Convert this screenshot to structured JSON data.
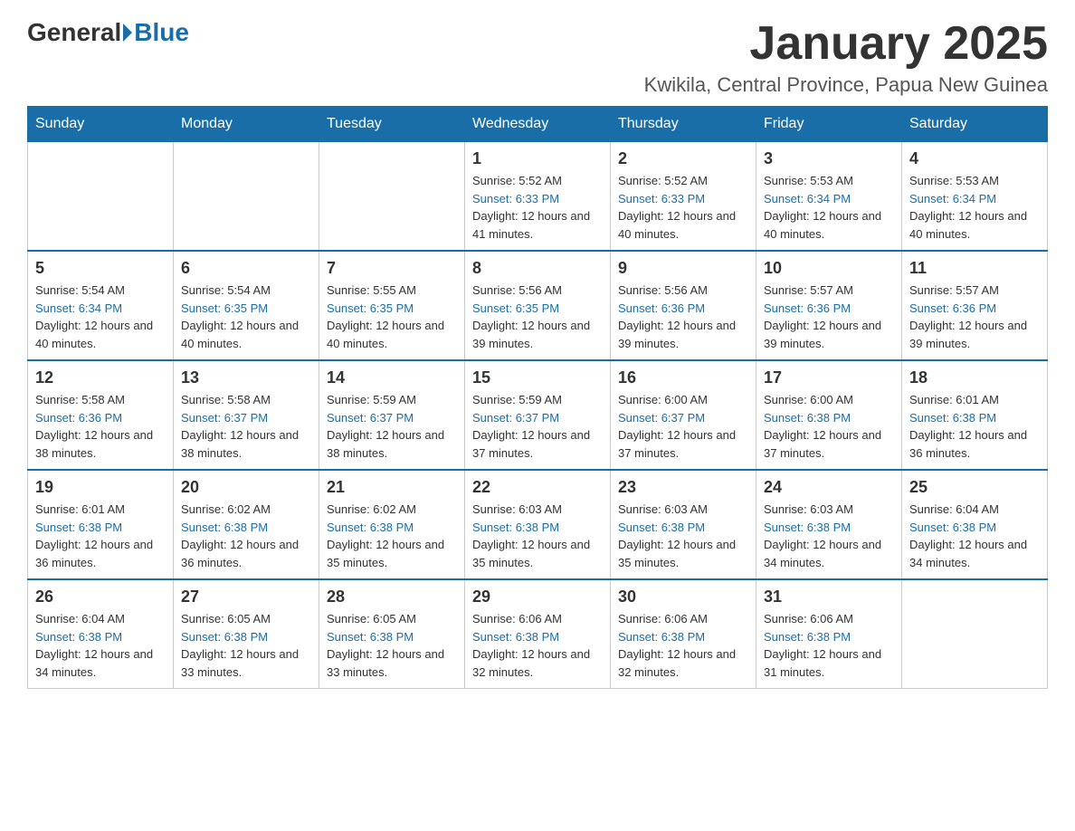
{
  "header": {
    "logo_general": "General",
    "logo_blue": "Blue",
    "month_title": "January 2025",
    "location": "Kwikila, Central Province, Papua New Guinea"
  },
  "days_of_week": [
    "Sunday",
    "Monday",
    "Tuesday",
    "Wednesday",
    "Thursday",
    "Friday",
    "Saturday"
  ],
  "weeks": [
    [
      {
        "day": "",
        "sunrise": "",
        "sunset": "",
        "daylight": ""
      },
      {
        "day": "",
        "sunrise": "",
        "sunset": "",
        "daylight": ""
      },
      {
        "day": "",
        "sunrise": "",
        "sunset": "",
        "daylight": ""
      },
      {
        "day": "1",
        "sunrise": "Sunrise: 5:52 AM",
        "sunset": "Sunset: 6:33 PM",
        "daylight": "Daylight: 12 hours and 41 minutes."
      },
      {
        "day": "2",
        "sunrise": "Sunrise: 5:52 AM",
        "sunset": "Sunset: 6:33 PM",
        "daylight": "Daylight: 12 hours and 40 minutes."
      },
      {
        "day": "3",
        "sunrise": "Sunrise: 5:53 AM",
        "sunset": "Sunset: 6:34 PM",
        "daylight": "Daylight: 12 hours and 40 minutes."
      },
      {
        "day": "4",
        "sunrise": "Sunrise: 5:53 AM",
        "sunset": "Sunset: 6:34 PM",
        "daylight": "Daylight: 12 hours and 40 minutes."
      }
    ],
    [
      {
        "day": "5",
        "sunrise": "Sunrise: 5:54 AM",
        "sunset": "Sunset: 6:34 PM",
        "daylight": "Daylight: 12 hours and 40 minutes."
      },
      {
        "day": "6",
        "sunrise": "Sunrise: 5:54 AM",
        "sunset": "Sunset: 6:35 PM",
        "daylight": "Daylight: 12 hours and 40 minutes."
      },
      {
        "day": "7",
        "sunrise": "Sunrise: 5:55 AM",
        "sunset": "Sunset: 6:35 PM",
        "daylight": "Daylight: 12 hours and 40 minutes."
      },
      {
        "day": "8",
        "sunrise": "Sunrise: 5:56 AM",
        "sunset": "Sunset: 6:35 PM",
        "daylight": "Daylight: 12 hours and 39 minutes."
      },
      {
        "day": "9",
        "sunrise": "Sunrise: 5:56 AM",
        "sunset": "Sunset: 6:36 PM",
        "daylight": "Daylight: 12 hours and 39 minutes."
      },
      {
        "day": "10",
        "sunrise": "Sunrise: 5:57 AM",
        "sunset": "Sunset: 6:36 PM",
        "daylight": "Daylight: 12 hours and 39 minutes."
      },
      {
        "day": "11",
        "sunrise": "Sunrise: 5:57 AM",
        "sunset": "Sunset: 6:36 PM",
        "daylight": "Daylight: 12 hours and 39 minutes."
      }
    ],
    [
      {
        "day": "12",
        "sunrise": "Sunrise: 5:58 AM",
        "sunset": "Sunset: 6:36 PM",
        "daylight": "Daylight: 12 hours and 38 minutes."
      },
      {
        "day": "13",
        "sunrise": "Sunrise: 5:58 AM",
        "sunset": "Sunset: 6:37 PM",
        "daylight": "Daylight: 12 hours and 38 minutes."
      },
      {
        "day": "14",
        "sunrise": "Sunrise: 5:59 AM",
        "sunset": "Sunset: 6:37 PM",
        "daylight": "Daylight: 12 hours and 38 minutes."
      },
      {
        "day": "15",
        "sunrise": "Sunrise: 5:59 AM",
        "sunset": "Sunset: 6:37 PM",
        "daylight": "Daylight: 12 hours and 37 minutes."
      },
      {
        "day": "16",
        "sunrise": "Sunrise: 6:00 AM",
        "sunset": "Sunset: 6:37 PM",
        "daylight": "Daylight: 12 hours and 37 minutes."
      },
      {
        "day": "17",
        "sunrise": "Sunrise: 6:00 AM",
        "sunset": "Sunset: 6:38 PM",
        "daylight": "Daylight: 12 hours and 37 minutes."
      },
      {
        "day": "18",
        "sunrise": "Sunrise: 6:01 AM",
        "sunset": "Sunset: 6:38 PM",
        "daylight": "Daylight: 12 hours and 36 minutes."
      }
    ],
    [
      {
        "day": "19",
        "sunrise": "Sunrise: 6:01 AM",
        "sunset": "Sunset: 6:38 PM",
        "daylight": "Daylight: 12 hours and 36 minutes."
      },
      {
        "day": "20",
        "sunrise": "Sunrise: 6:02 AM",
        "sunset": "Sunset: 6:38 PM",
        "daylight": "Daylight: 12 hours and 36 minutes."
      },
      {
        "day": "21",
        "sunrise": "Sunrise: 6:02 AM",
        "sunset": "Sunset: 6:38 PM",
        "daylight": "Daylight: 12 hours and 35 minutes."
      },
      {
        "day": "22",
        "sunrise": "Sunrise: 6:03 AM",
        "sunset": "Sunset: 6:38 PM",
        "daylight": "Daylight: 12 hours and 35 minutes."
      },
      {
        "day": "23",
        "sunrise": "Sunrise: 6:03 AM",
        "sunset": "Sunset: 6:38 PM",
        "daylight": "Daylight: 12 hours and 35 minutes."
      },
      {
        "day": "24",
        "sunrise": "Sunrise: 6:03 AM",
        "sunset": "Sunset: 6:38 PM",
        "daylight": "Daylight: 12 hours and 34 minutes."
      },
      {
        "day": "25",
        "sunrise": "Sunrise: 6:04 AM",
        "sunset": "Sunset: 6:38 PM",
        "daylight": "Daylight: 12 hours and 34 minutes."
      }
    ],
    [
      {
        "day": "26",
        "sunrise": "Sunrise: 6:04 AM",
        "sunset": "Sunset: 6:38 PM",
        "daylight": "Daylight: 12 hours and 34 minutes."
      },
      {
        "day": "27",
        "sunrise": "Sunrise: 6:05 AM",
        "sunset": "Sunset: 6:38 PM",
        "daylight": "Daylight: 12 hours and 33 minutes."
      },
      {
        "day": "28",
        "sunrise": "Sunrise: 6:05 AM",
        "sunset": "Sunset: 6:38 PM",
        "daylight": "Daylight: 12 hours and 33 minutes."
      },
      {
        "day": "29",
        "sunrise": "Sunrise: 6:06 AM",
        "sunset": "Sunset: 6:38 PM",
        "daylight": "Daylight: 12 hours and 32 minutes."
      },
      {
        "day": "30",
        "sunrise": "Sunrise: 6:06 AM",
        "sunset": "Sunset: 6:38 PM",
        "daylight": "Daylight: 12 hours and 32 minutes."
      },
      {
        "day": "31",
        "sunrise": "Sunrise: 6:06 AM",
        "sunset": "Sunset: 6:38 PM",
        "daylight": "Daylight: 12 hours and 31 minutes."
      },
      {
        "day": "",
        "sunrise": "",
        "sunset": "",
        "daylight": ""
      }
    ]
  ]
}
